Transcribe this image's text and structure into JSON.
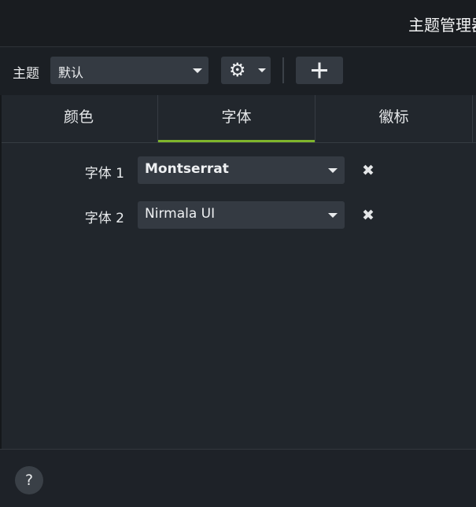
{
  "window": {
    "title": "主题管理器"
  },
  "toolbar": {
    "theme_label": "主题",
    "theme_value": "默认",
    "gear_icon": "gear-icon",
    "add_icon": "plus-icon"
  },
  "tabs": [
    {
      "label": "颜色"
    },
    {
      "label": "字体",
      "active": true
    },
    {
      "label": "徽标"
    }
  ],
  "fonts": [
    {
      "label": "字体 1",
      "value": "Montserrat"
    },
    {
      "label": "字体 2",
      "value": "Nirmala UI"
    }
  ],
  "footer": {
    "help_label": "?"
  },
  "colors": {
    "accent": "#7fb52c",
    "background": "#21262c",
    "control": "#343a42"
  }
}
